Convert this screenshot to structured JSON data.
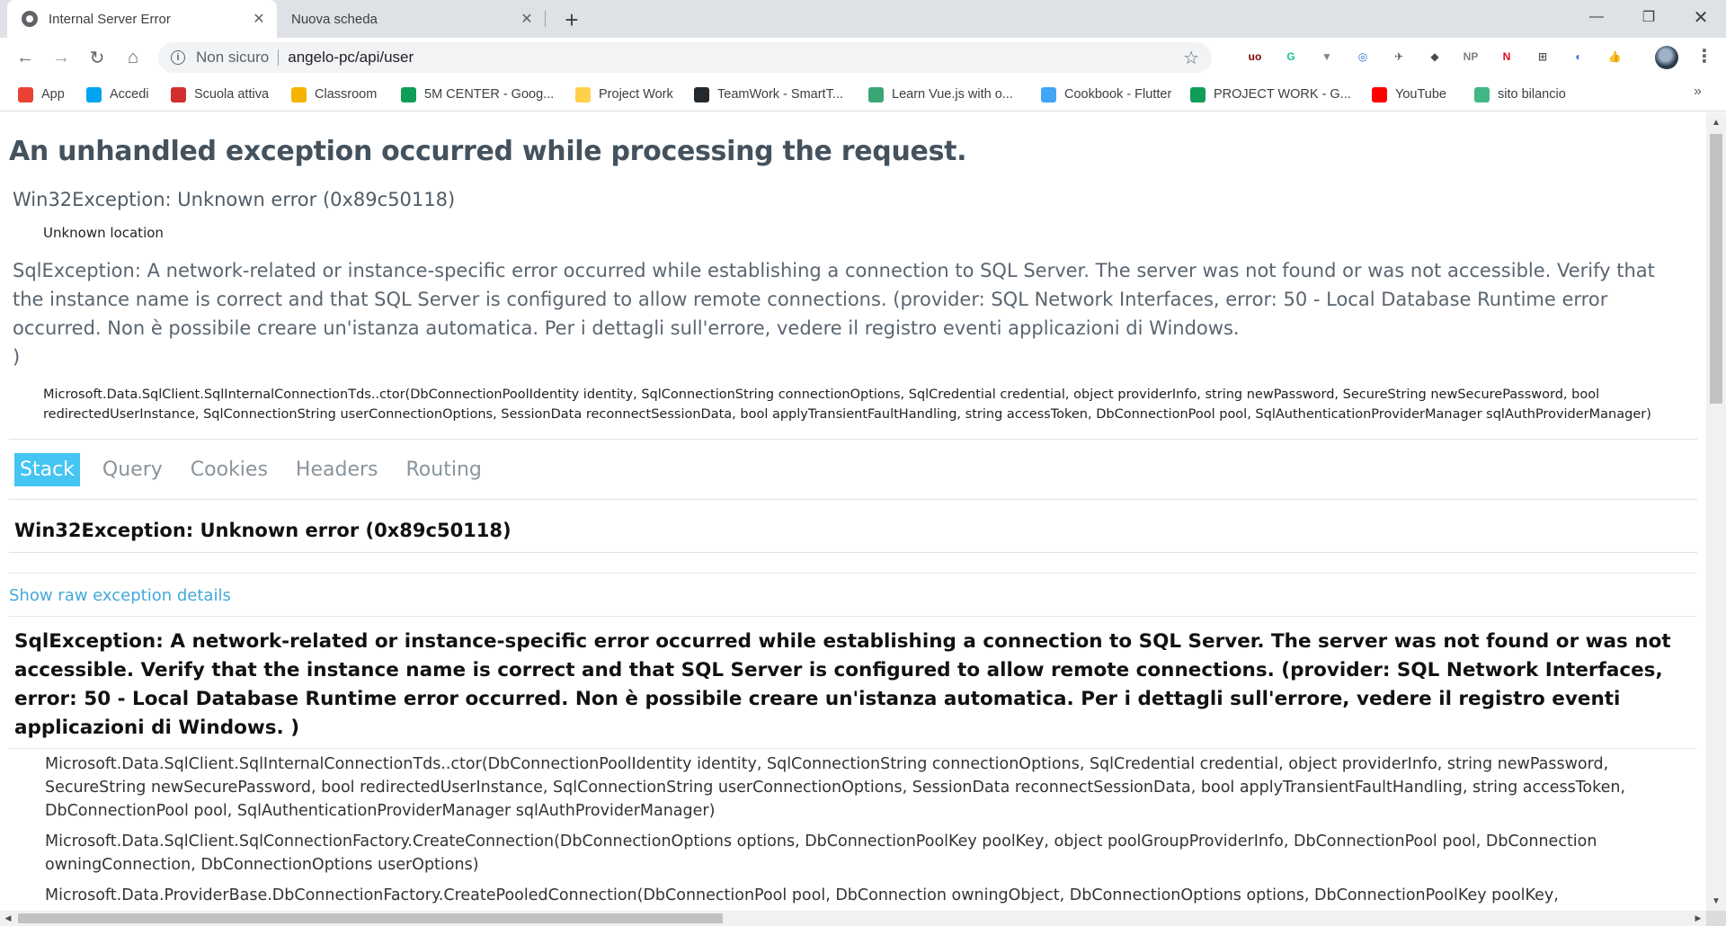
{
  "browser": {
    "tabs": [
      {
        "title": "Internal Server Error",
        "active": true,
        "close": "✕"
      },
      {
        "title": "Nuova scheda",
        "active": false,
        "close": "✕"
      }
    ],
    "new_tab": "+",
    "window_controls": {
      "minimize": "—",
      "maximize": "❐",
      "close": "✕"
    },
    "nav": {
      "back": "←",
      "forward": "→",
      "reload": "↻",
      "home": "⌂"
    },
    "omnibox": {
      "info_icon": "i",
      "security_label": "Non sicuro",
      "url": "angelo-pc/api/user",
      "star": "☆"
    },
    "extensions": [
      {
        "name": "ublock-icon",
        "glyph": "uo",
        "color": "#800000"
      },
      {
        "name": "grammarly-icon",
        "glyph": "G",
        "color": "#15c39a"
      },
      {
        "name": "vue-devtools-icon",
        "glyph": "▼",
        "color": "#7d8590"
      },
      {
        "name": "extension-ring-icon",
        "glyph": "◎",
        "color": "#2a6fd6"
      },
      {
        "name": "extension-rocket-icon",
        "glyph": "✈",
        "color": "#555555"
      },
      {
        "name": "extension-shield-icon",
        "glyph": "◆",
        "color": "#4a4a4a"
      },
      {
        "name": "np-icon",
        "glyph": "NP",
        "color": "#808080"
      },
      {
        "name": "netflix-icon",
        "glyph": "N",
        "color": "#e50914"
      },
      {
        "name": "extension-grid-icon",
        "glyph": "⊞",
        "color": "#555555"
      },
      {
        "name": "extension-blue-icon",
        "glyph": "◐",
        "color": "#3b6fd8"
      },
      {
        "name": "thumb-icon",
        "glyph": "👍",
        "color": "#f2b600"
      }
    ],
    "menu": "⋮",
    "bookmarks": [
      {
        "label": "App",
        "icon": "apps-grid-icon",
        "color": "#ea4335"
      },
      {
        "label": "Accedi",
        "icon": "microsoft-icon",
        "color": "#00a4ef"
      },
      {
        "label": "Scuola attiva",
        "icon": "scuola-attiva-icon",
        "color": "#d32f2f"
      },
      {
        "label": "Classroom",
        "icon": "classroom-icon",
        "color": "#f4b400"
      },
      {
        "label": "5M CENTER - Goog...",
        "icon": "google-drive-icon",
        "color": "#0f9d58"
      },
      {
        "label": "Project Work",
        "icon": "folder-icon",
        "color": "#ffd04b"
      },
      {
        "label": "TeamWork - SmartT...",
        "icon": "github-icon",
        "color": "#24292e"
      },
      {
        "label": "Learn Vue.js with o...",
        "icon": "vue-mastery-icon",
        "color": "#3aa675"
      },
      {
        "label": "Cookbook - Flutter",
        "icon": "flutter-icon",
        "color": "#42a5f5"
      },
      {
        "label": "PROJECT WORK - G...",
        "icon": "google-drive-icon",
        "color": "#0f9d58"
      },
      {
        "label": "YouTube",
        "icon": "youtube-icon",
        "color": "#ff0000"
      },
      {
        "label": "sito bilancio",
        "icon": "vue-icon",
        "color": "#41b883"
      }
    ],
    "bookmarks_more": "»"
  },
  "page": {
    "heading": "An unhandled exception occurred while processing the request.",
    "win32_error": "Win32Exception: Unknown error (0x89c50118)",
    "win32_location": "Unknown location",
    "sql_message_1": "SqlException: A network-related or instance-specific error occurred while establishing a connection to SQL Server. The server was not found or was not accessible. Verify that the instance name is correct and that SQL Server is configured to allow remote connections. (provider: SQL Network Interfaces, error: 50 - Local Database Runtime error occurred. Non è possibile creare un'istanza automatica. Per i dettagli sull'errore, vedere il registro eventi applicazioni di Windows.",
    "sql_message_2": ")",
    "sql_location": "Microsoft.Data.SqlClient.SqlInternalConnectionTds..ctor(DbConnectionPoolIdentity identity, SqlConnectionString connectionOptions, SqlCredential credential, object providerInfo, string newPassword, SecureString newSecurePassword, bool redirectedUserInstance, SqlConnectionString userConnectionOptions, SessionData reconnectSessionData, bool applyTransientFaultHandling, string accessToken, DbConnectionPool pool, SqlAuthenticationProviderManager sqlAuthProviderManager)",
    "tabs": [
      "Stack",
      "Query",
      "Cookies",
      "Headers",
      "Routing"
    ],
    "stack_title": "Win32Exception: Unknown error (0x89c50118)",
    "raw_link": "Show raw exception details",
    "frame_title": "SqlException: A network-related or instance-specific error occurred while establishing a connection to SQL Server. The server was not found or was not accessible. Verify that the instance name is correct and that SQL Server is configured to allow remote connections. (provider: SQL Network Interfaces, error: 50 - Local Database Runtime error occurred. Non è possibile creare un'istanza automatica. Per i dettagli sull'errore, vedere il registro eventi applicazioni di Windows. )",
    "frames": [
      "Microsoft.Data.SqlClient.SqlInternalConnectionTds..ctor(DbConnectionPoolIdentity identity, SqlConnectionString connectionOptions, SqlCredential credential, object providerInfo, string newPassword, SecureString newSecurePassword, bool redirectedUserInstance, SqlConnectionString userConnectionOptions, SessionData reconnectSessionData, bool applyTransientFaultHandling, string accessToken, DbConnectionPool pool, SqlAuthenticationProviderManager sqlAuthProviderManager)",
      "Microsoft.Data.SqlClient.SqlConnectionFactory.CreateConnection(DbConnectionOptions options, DbConnectionPoolKey poolKey, object poolGroupProviderInfo, DbConnectionPool pool, DbConnection owningConnection, DbConnectionOptions userOptions)",
      "Microsoft.Data.ProviderBase.DbConnectionFactory.CreatePooledConnection(DbConnectionPool pool, DbConnection owningObject, DbConnectionOptions options, DbConnectionPoolKey poolKey, DbConnectionOptions userOptions)"
    ]
  },
  "scrollbars": {
    "up": "▲",
    "down": "▼",
    "left": "◀",
    "right": "▶"
  }
}
